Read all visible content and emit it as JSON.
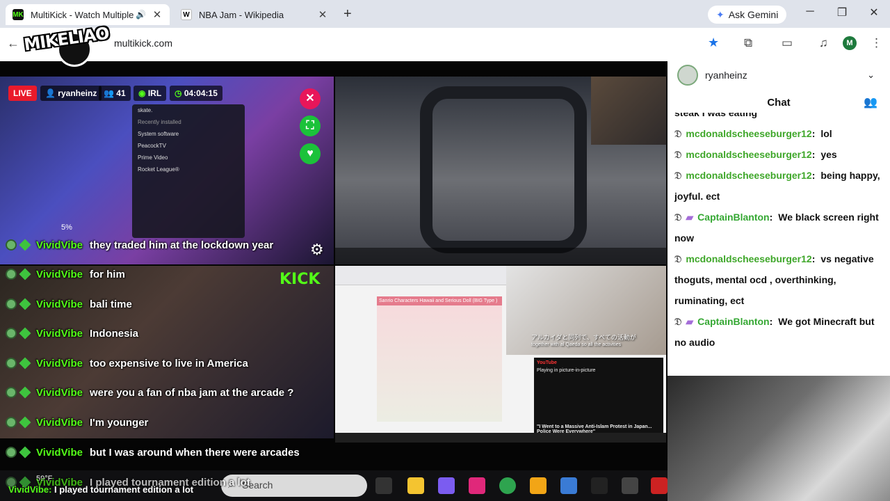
{
  "browser": {
    "tabs": [
      {
        "title": "MultiKick - Watch Multiple Kick Streams",
        "favicon": "MK",
        "active": true
      },
      {
        "title": "NBA Jam - Wikipedia",
        "favicon": "W",
        "active": false
      }
    ],
    "new_tab": "+",
    "gemini_label": "Ask Gemini",
    "url": "multikick.com",
    "profile_initial": "M"
  },
  "overlay_logo": "MIKELIAO",
  "stream_hud": {
    "live": "LIVE",
    "streamer": "ryanheinz",
    "viewers": "41",
    "category": "IRL",
    "uptime": "04:04:15",
    "percent": "5%",
    "kick_logo": "KICK"
  },
  "overlay_chat": [
    {
      "user": "VividVibe",
      "text": "they traded him at the lockdown year"
    },
    {
      "user": "VividVibe",
      "text": "for him"
    },
    {
      "user": "VividVibe",
      "text": "bali time"
    },
    {
      "user": "VividVibe",
      "text": "Indonesia"
    },
    {
      "user": "VividVibe",
      "text": "too expensive to live in America"
    },
    {
      "user": "VividVibe",
      "text": "were you a fan of nba jam at the arcade ?"
    },
    {
      "user": "VividVibe",
      "text": "I'm younger"
    },
    {
      "user": "VividVibe",
      "text": "but I was around when there were arcades"
    },
    {
      "user": "VividVibe",
      "text": "I played tournament edition a lot"
    }
  ],
  "ticker": {
    "user": "VividVibe",
    "text": "I played tournament edition a lot"
  },
  "game_menu": {
    "current": "skate.",
    "recent_header": "Recently installed",
    "items": [
      "System software",
      "PeacockTV",
      "Prime Video",
      "Rocket League®"
    ]
  },
  "stream4": {
    "page_title": "Sanrio Characters Hawaii and Serious Doll (BIG Type )",
    "caption_jp": "アルカイダと同列で、すべての活動が",
    "caption_en": "together with al Qaeda so all the activities",
    "yt_label": "YouTube",
    "pip_text": "Playing in picture-in-picture",
    "video_title": "\"I Went to a Massive Anti-Islam Protest in Japan... Police Were Everywhere\""
  },
  "sidebar": {
    "channel": "ryanheinz",
    "chat_title": "Chat",
    "partial_top": "steak I was eating",
    "messages": [
      {
        "badge": "𝔇",
        "sub": false,
        "user": "mcdonaldscheeseburger12",
        "text": "lol"
      },
      {
        "badge": "𝔇",
        "sub": false,
        "user": "mcdonaldscheeseburger12",
        "text": "yes"
      },
      {
        "badge": "𝔇",
        "sub": false,
        "user": "mcdonaldscheeseburger12",
        "text": "being happy, joyful. ect"
      },
      {
        "badge": "𝔇",
        "sub": true,
        "user": "CaptainBlanton",
        "text": "We black screen right now"
      },
      {
        "badge": "𝔇",
        "sub": false,
        "user": "mcdonaldscheeseburger12",
        "text": "vs negative thoguts, mental ocd , overthinking, ruminating, ect"
      },
      {
        "badge": "𝔇",
        "sub": true,
        "user": "CaptainBlanton",
        "text": "We got Minecraft but no audio"
      }
    ]
  },
  "taskbar": {
    "weather": "59°F",
    "search_placeholder": "Search"
  },
  "colors": {
    "kick_green": "#53fc18",
    "live_red": "#ea1a2b",
    "accent_blue": "#1a73e8"
  }
}
